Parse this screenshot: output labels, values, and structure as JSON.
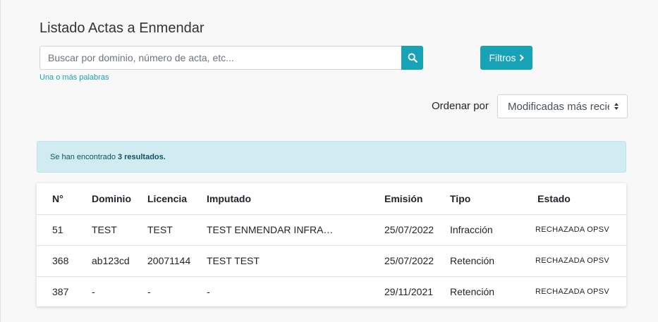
{
  "page": {
    "title": "Listado Actas a Enmendar"
  },
  "search": {
    "placeholder": "Buscar por dominio, número de acta, etc...",
    "value": "",
    "hint": "Una o más palabras",
    "icon": "search-icon"
  },
  "filters": {
    "label": "Filtros",
    "icon": "chevron-right-icon"
  },
  "sort": {
    "label": "Ordenar por",
    "selected": "Modificadas más recientes"
  },
  "alert": {
    "prefix": "Se han encontrado",
    "count_text": "3 resultados."
  },
  "table": {
    "headers": {
      "numero": "N°",
      "dominio": "Dominio",
      "licencia": "Licencia",
      "imputado": "Imputado",
      "emision": "Emisión",
      "tipo": "Tipo",
      "estado": "Estado"
    },
    "rows": [
      {
        "numero": "51",
        "dominio": "TEST",
        "licencia": "TEST",
        "imputado": "TEST ENMENDAR INFRA…",
        "emision": "25/07/2022",
        "tipo": "Infracción",
        "estado": "RECHAZADA OPSV"
      },
      {
        "numero": "368",
        "dominio": "ab123cd",
        "licencia": "20071144",
        "imputado": "TEST TEST",
        "emision": "25/07/2022",
        "tipo": "Retención",
        "estado": "RECHAZADA OPSV"
      },
      {
        "numero": "387",
        "dominio": "-",
        "licencia": "-",
        "imputado": "-",
        "emision": "29/11/2021",
        "tipo": "Retención",
        "estado": "RECHAZADA OPSV"
      }
    ]
  },
  "colors": {
    "accent": "#17a2b8",
    "alert_bg": "#d1ecf1",
    "alert_text": "#0c5460"
  }
}
